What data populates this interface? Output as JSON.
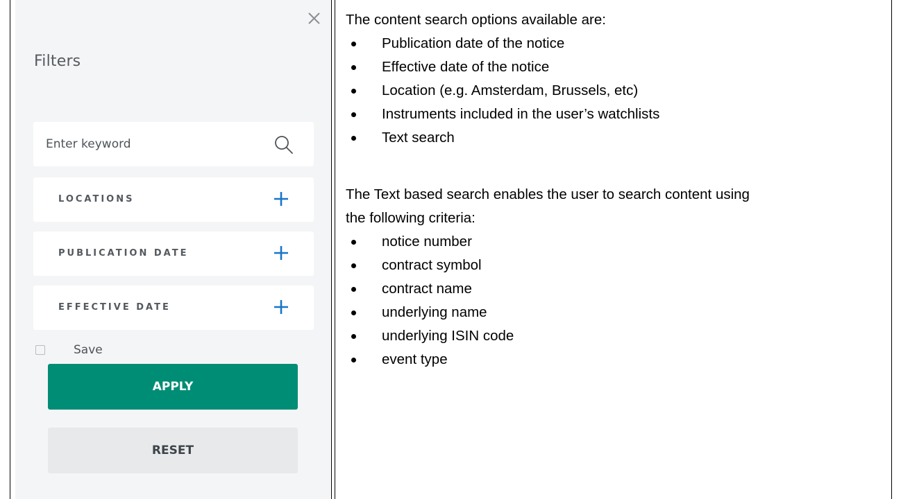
{
  "filter_panel": {
    "title": "Filters",
    "search": {
      "placeholder": "Enter keyword"
    },
    "filters": [
      {
        "label": "LOCATIONS"
      },
      {
        "label": "PUBLICATION DATE"
      },
      {
        "label": "EFFECTIVE DATE"
      }
    ],
    "save_label": "Save",
    "save_checked": false,
    "apply_label": "APPLY",
    "reset_label": "RESET",
    "colors": {
      "panel_bg": "#f4f5f6",
      "apply_bg": "#008d76",
      "reset_bg": "#e7e9eb",
      "plus_icon": "#1a73c9"
    }
  },
  "description": {
    "intro": "The content search options available are:",
    "options": [
      "Publication date of the notice",
      "Effective date of the notice",
      "Location (e.g. Amsterdam, Brussels, etc)",
      "Instruments included in the user’s watchlists",
      "Text search"
    ],
    "text_search_intro_line1": "The Text based search enables the user to search content using",
    "text_search_intro_line2": "the following criteria:",
    "criteria": [
      "notice number",
      "contract symbol",
      "contract name",
      "underlying name",
      "underlying ISIN code",
      "event type"
    ]
  }
}
